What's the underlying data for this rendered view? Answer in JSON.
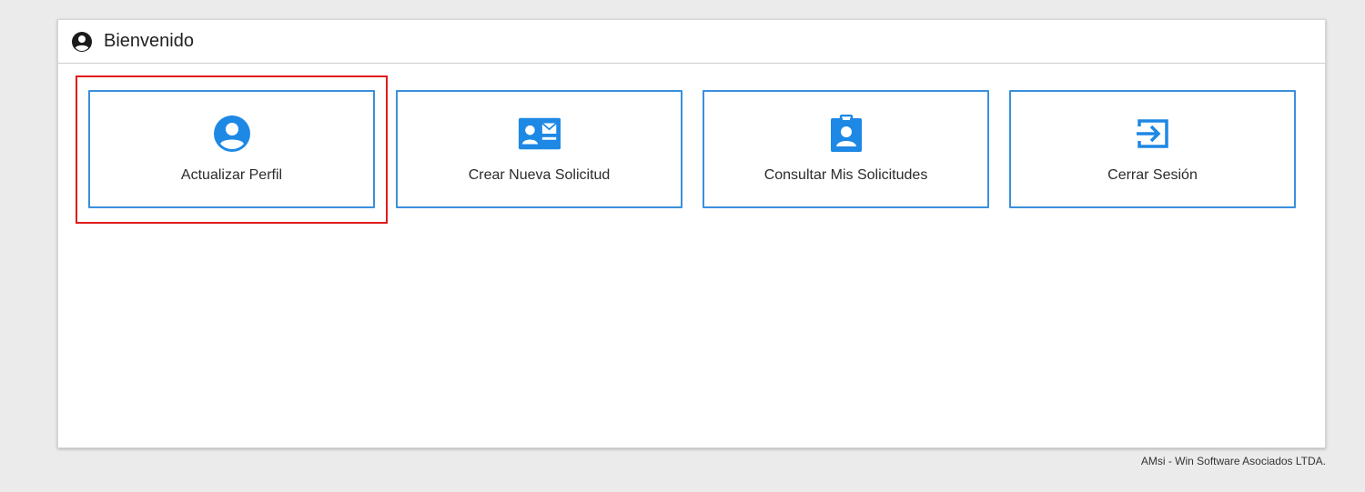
{
  "panel": {
    "title": "Bienvenido",
    "icon": "user-circle-icon"
  },
  "tiles": [
    {
      "label": "Actualizar Perfil",
      "icon": "user-circle-icon",
      "highlighted": true
    },
    {
      "label": "Crear Nueva Solicitud",
      "icon": "contact-card-envelope-icon"
    },
    {
      "label": "Consultar Mis Solicitudes",
      "icon": "id-badge-icon"
    },
    {
      "label": "Cerrar Sesión",
      "icon": "sign-out-icon"
    }
  ],
  "footer": {
    "text": "AMsi - Win Software Asociados LTDA."
  },
  "colors": {
    "accent": "#1e88e5",
    "tile_border": "#3a8fdc",
    "highlight": "#e01b1b",
    "background": "#ebebeb"
  }
}
